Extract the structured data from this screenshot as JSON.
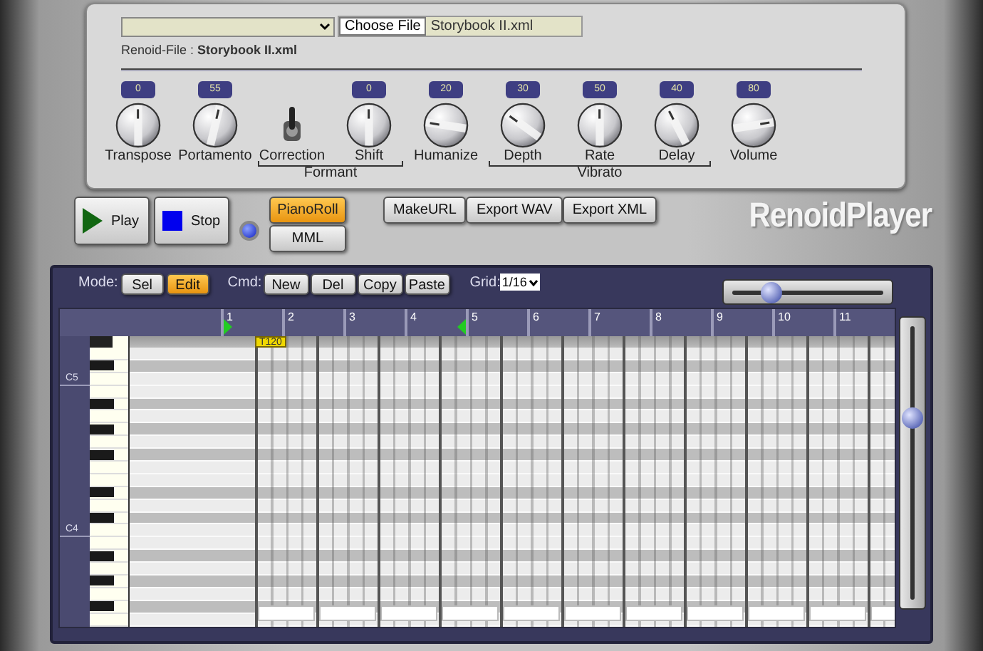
{
  "file": {
    "button": "Choose File",
    "name": "Storybook II.xml"
  },
  "renoid_file": {
    "label": "Renoid-File : ",
    "name": "Storybook II.xml"
  },
  "controls": [
    {
      "kind": "bipolar-knob",
      "label": "Transpose",
      "value": "0"
    },
    {
      "kind": "knob",
      "label": "Portamento",
      "value": "55"
    },
    {
      "kind": "group",
      "label": "Formant",
      "items": [
        {
          "kind": "switch",
          "label": "Correction",
          "on": true
        },
        {
          "kind": "bipolar-knob",
          "label": "Shift",
          "value": "0"
        }
      ]
    },
    {
      "kind": "knob",
      "label": "Humanize",
      "value": "20"
    },
    {
      "kind": "group",
      "label": "Vibrato",
      "items": [
        {
          "kind": "knob",
          "label": "Depth",
          "value": "30"
        },
        {
          "kind": "knob",
          "label": "Rate",
          "value": "50"
        },
        {
          "kind": "knob",
          "label": "Delay",
          "value": "40"
        }
      ]
    },
    {
      "kind": "knob",
      "label": "Volume",
      "value": "80"
    }
  ],
  "transport": [
    {
      "kind": "play",
      "label": "Play"
    },
    {
      "kind": "stop",
      "label": "Stop"
    }
  ],
  "indicator": {
    "on": true
  },
  "view_buttons": [
    {
      "label": "PianoRoll",
      "selected": true
    },
    {
      "label": "MML",
      "selected": false
    }
  ],
  "export_buttons": [
    "MakeURL",
    "Export WAV",
    "Export XML"
  ],
  "logo": "RenoidPlayer",
  "editor": {
    "mode_label": "Mode:",
    "modes": [
      {
        "label": "Sel",
        "selected": false
      },
      {
        "label": "Edit",
        "selected": true
      }
    ],
    "cmd_label": "Cmd:",
    "commands": [
      "New",
      "Del",
      "Copy",
      "Paste"
    ],
    "grid_label": "Grid:",
    "grid_value": "1/16",
    "zoom_slider": {
      "level": 0.25
    },
    "measures": [
      {
        "label": "1",
        "kind": "loop-start"
      },
      {
        "label": "2",
        "kind": "plain"
      },
      {
        "label": "3",
        "kind": "plain"
      },
      {
        "label": "4",
        "kind": "plain"
      },
      {
        "label": "5",
        "kind": "loop-end"
      },
      {
        "label": "6",
        "kind": "plain"
      },
      {
        "label": "7",
        "kind": "plain"
      },
      {
        "label": "8",
        "kind": "plain"
      },
      {
        "label": "9",
        "kind": "plain"
      },
      {
        "label": "10",
        "kind": "plain"
      },
      {
        "label": "11",
        "kind": "plain"
      }
    ],
    "tempo_marker": "T120",
    "key_labels": [
      "C5",
      "C4"
    ],
    "vertical_slider": {
      "level": 0.66
    }
  }
}
